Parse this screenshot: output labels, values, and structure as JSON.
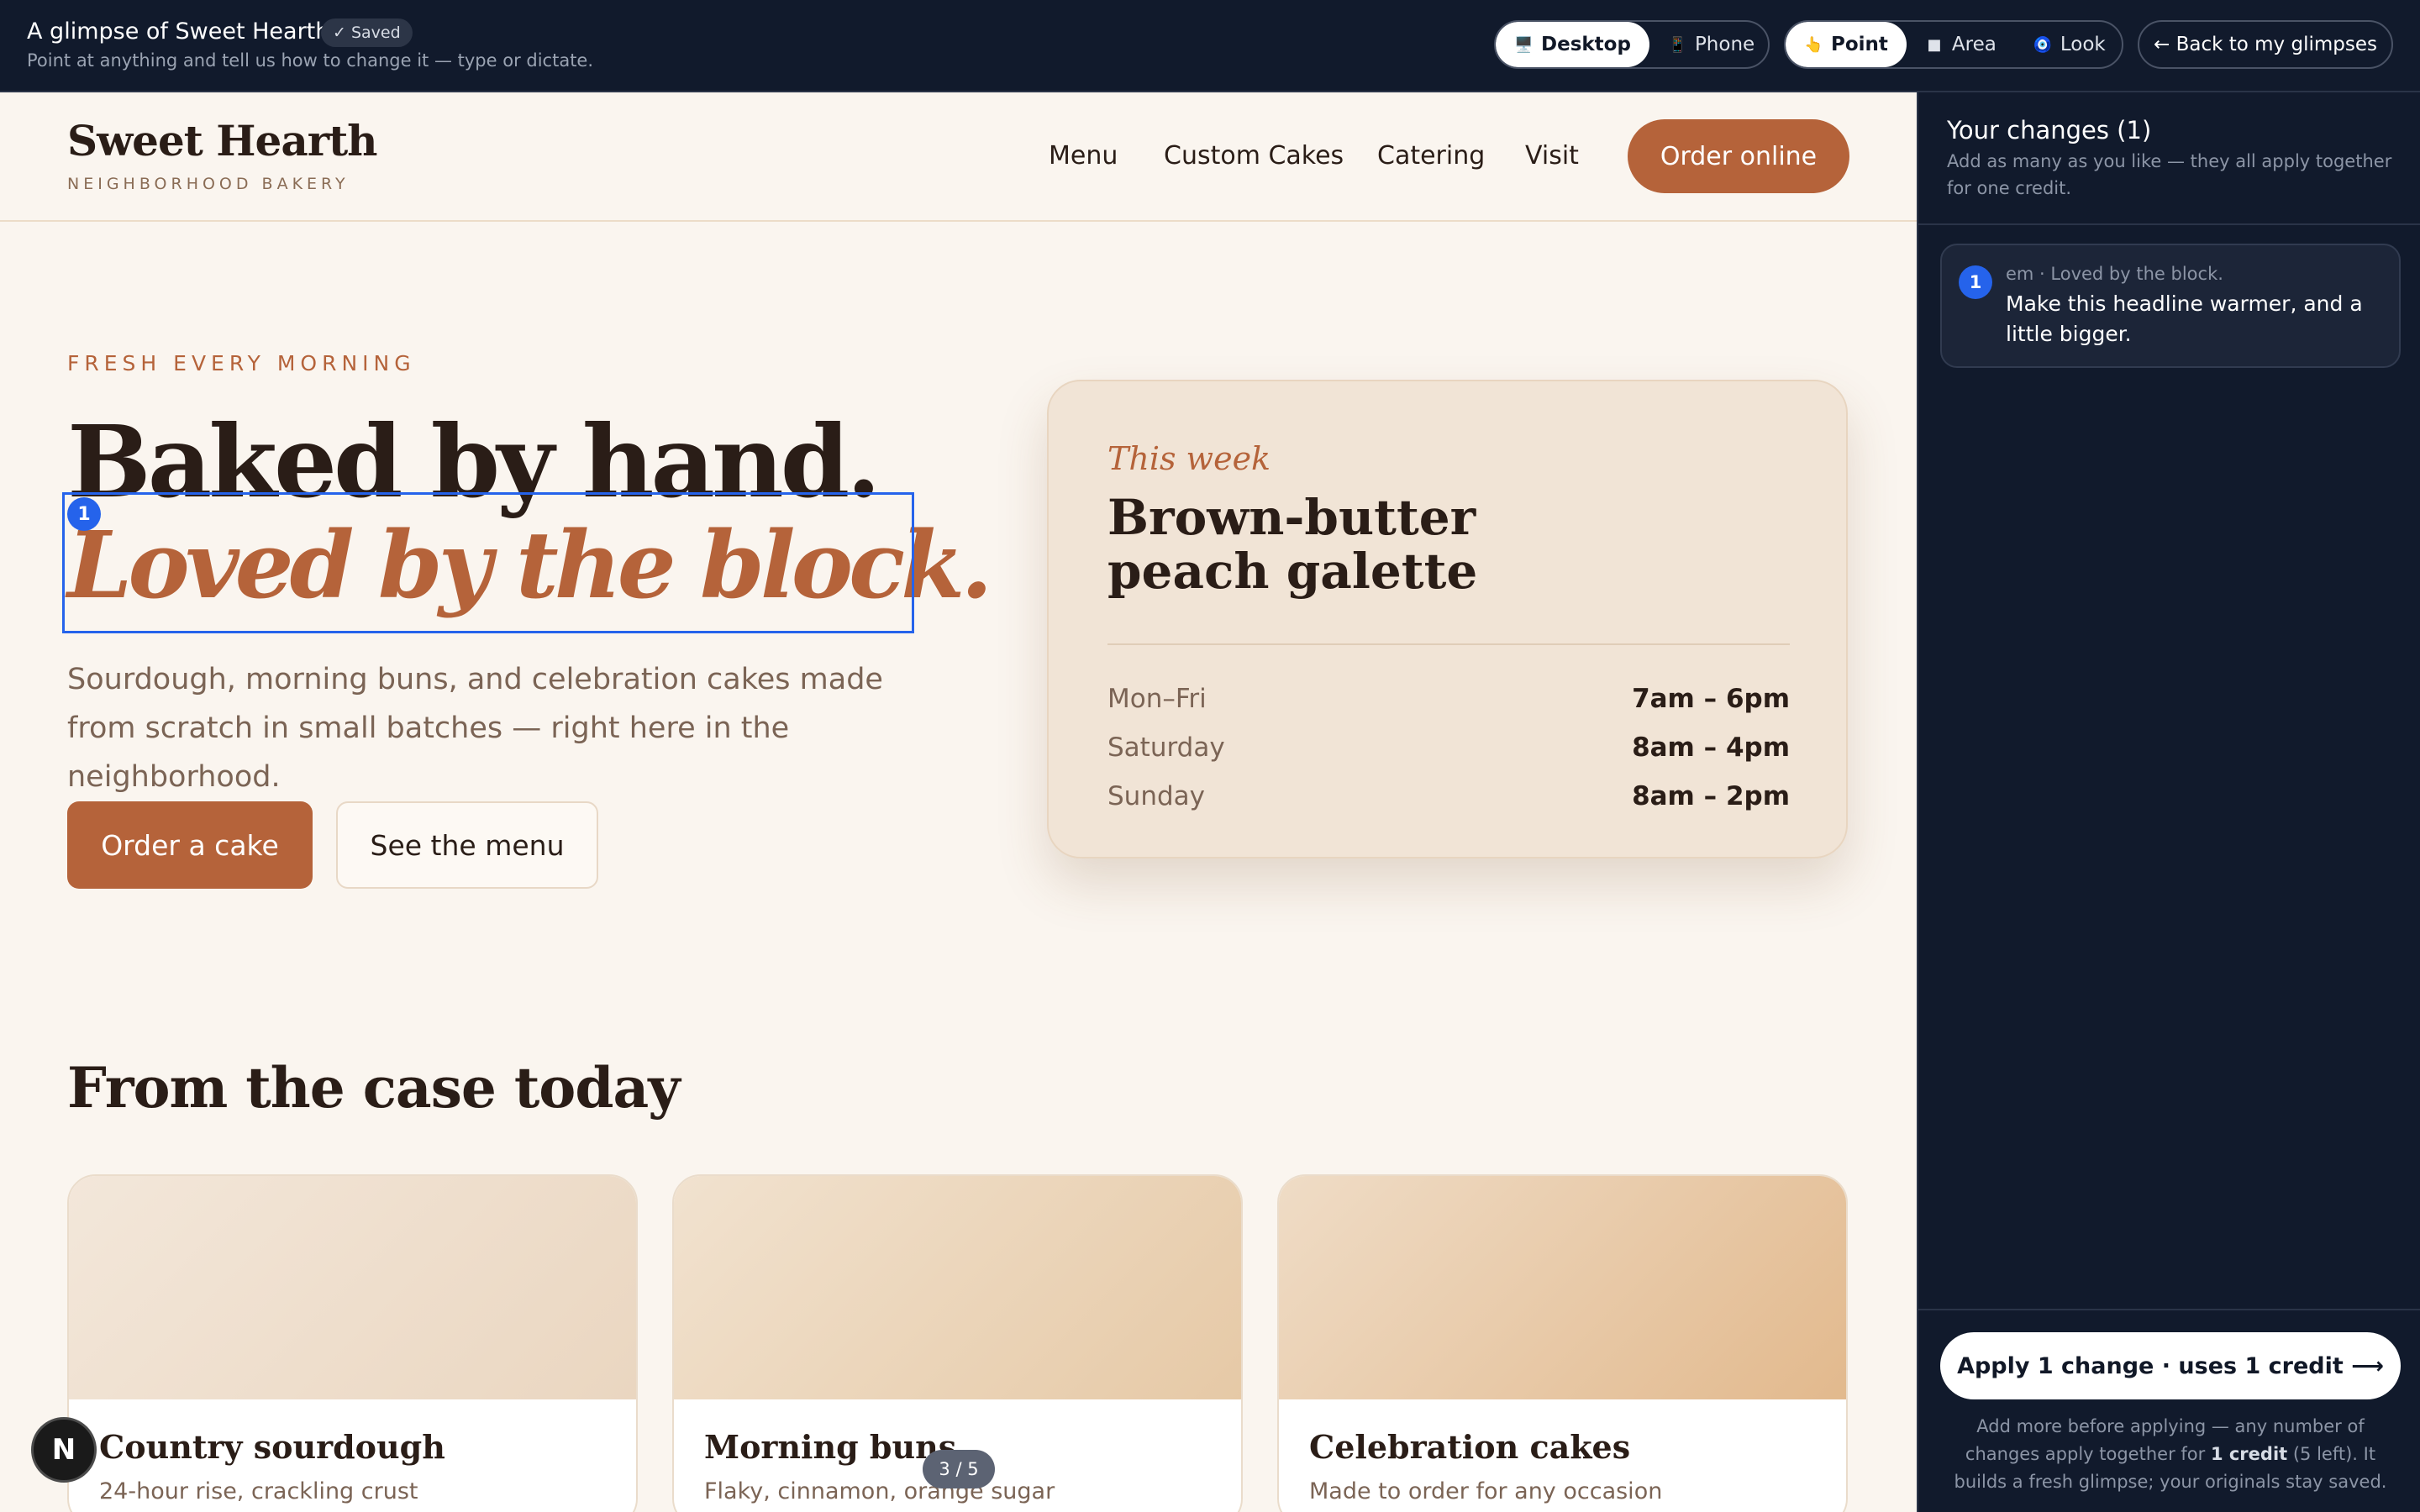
{
  "topbar": {
    "title": "A glimpse of Sweet Hearth",
    "saved_badge": "✓ Saved",
    "subtitle": "Point at anything and tell us how to change it — type or dictate.",
    "device_options": [
      {
        "icon": "🖥️",
        "label": "Desktop",
        "active": true
      },
      {
        "icon": "📱",
        "label": "Phone",
        "active": false
      }
    ],
    "mode_options": [
      {
        "icon": "👆",
        "label": "Point",
        "active": true
      },
      {
        "icon": "■",
        "label": "Area",
        "active": false
      },
      {
        "icon": "🧿",
        "label": "Look",
        "active": false
      }
    ],
    "back_label": "← Back to my glimpses"
  },
  "site": {
    "brand": "Sweet Hearth",
    "brand_tagline": "NEIGHBORHOOD BAKERY",
    "nav": [
      "Menu",
      "Custom Cakes",
      "Catering",
      "Visit"
    ],
    "order_online": "Order online",
    "hero": {
      "eyebrow": "FRESH EVERY MORNING",
      "headline_line1": "Baked by hand.",
      "headline_line2": "Loved by the block.",
      "lede": "Sourdough, morning buns, and celebration cakes made from scratch in small batches — right here in the neighborhood.",
      "primary_cta": "Order a cake",
      "secondary_cta": "See the menu",
      "selection_marker": "1"
    },
    "this_week": {
      "label": "This week",
      "item": "Brown-butter peach galette",
      "hours": [
        {
          "day": "Mon–Fri",
          "time": "7am – 6pm"
        },
        {
          "day": "Saturday",
          "time": "8am – 4pm"
        },
        {
          "day": "Sunday",
          "time": "8am – 2pm"
        }
      ]
    },
    "case": {
      "title": "From the case today",
      "products": [
        {
          "name": "Country sourdough",
          "desc": "24-hour rise, crackling crust"
        },
        {
          "name": "Morning buns",
          "desc": "Flaky, cinnamon, orange sugar"
        },
        {
          "name": "Celebration cakes",
          "desc": "Made to order for any occasion"
        }
      ]
    }
  },
  "overlay": {
    "fab_label": "N",
    "pager": "3 / 5"
  },
  "panel": {
    "title": "Your changes (1)",
    "subtitle": "Add as many as you like — they all apply together for one credit.",
    "changes": [
      {
        "index": "1",
        "meta": "em · Loved by the block.",
        "text": "Make this headline warmer, and a little bigger."
      }
    ],
    "apply_label": "Apply 1 change · uses 1 credit ⟶",
    "footer_pre": "Add more before applying — any number of changes apply together for ",
    "footer_bold": "1 credit",
    "footer_post": " (5 left). It builds a fresh glimpse; your originals stay saved."
  },
  "colors": {
    "accent": "#b5633a",
    "selection": "#2563eb",
    "dark_chrome": "#111a2c",
    "canvas_bg": "#faf5ef"
  }
}
